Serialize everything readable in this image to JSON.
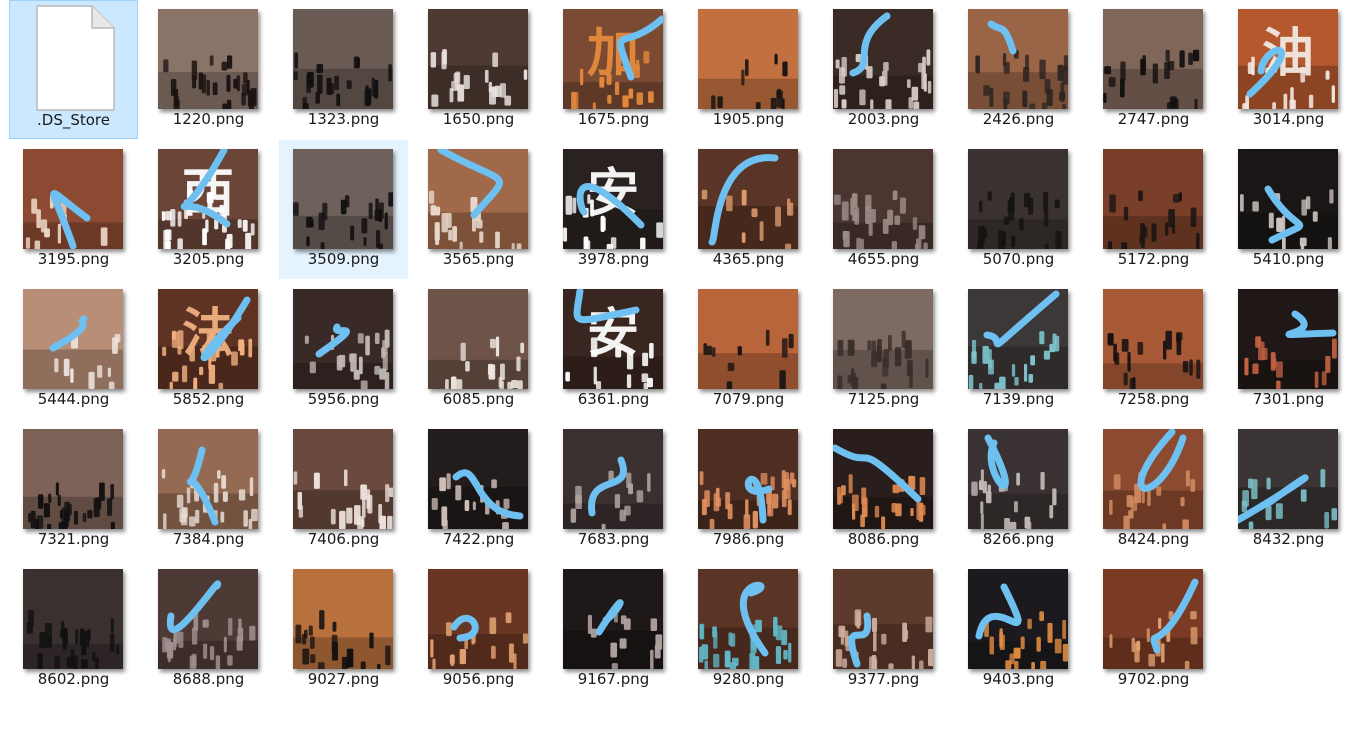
{
  "files": [
    {
      "name": ".DS_Store",
      "type": "file",
      "selected": true
    },
    {
      "name": "1220.png",
      "type": "image",
      "bg": "#8a7468",
      "fg": "#1a1312",
      "ink": false,
      "glyph": ""
    },
    {
      "name": "1323.png",
      "type": "image",
      "bg": "#6b5b55",
      "fg": "#121010",
      "ink": false,
      "glyph": ""
    },
    {
      "name": "1650.png",
      "type": "image",
      "bg": "#4e3a33",
      "fg": "#e9e2de",
      "ink": false,
      "glyph": ""
    },
    {
      "name": "1675.png",
      "type": "image",
      "bg": "#7a4a32",
      "fg": "#e58a3c",
      "ink": true,
      "glyph": "加"
    },
    {
      "name": "1905.png",
      "type": "image",
      "bg": "#c2703f",
      "fg": "#161212",
      "ink": false,
      "glyph": ""
    },
    {
      "name": "2003.png",
      "type": "image",
      "bg": "#3b2b26",
      "fg": "#d9d0ca",
      "ink": true,
      "glyph": ""
    },
    {
      "name": "2426.png",
      "type": "image",
      "bg": "#9a6547",
      "fg": "#2e2522",
      "ink": true,
      "glyph": ""
    },
    {
      "name": "2747.png",
      "type": "image",
      "bg": "#7f6659",
      "fg": "#121010",
      "ink": false,
      "glyph": ""
    },
    {
      "name": "3014.png",
      "type": "image",
      "bg": "#b5582e",
      "fg": "#f3e8e2",
      "ink": true,
      "glyph": "油"
    },
    {
      "name": "3195.png",
      "type": "image",
      "bg": "#8c4a32",
      "fg": "#f0d9c9",
      "ink": true,
      "glyph": ""
    },
    {
      "name": "3205.png",
      "type": "image",
      "bg": "#6a4538",
      "fg": "#ffffff",
      "ink": true,
      "glyph": "西"
    },
    {
      "name": "3509.png",
      "type": "image",
      "bg": "#6e605a",
      "fg": "#121010",
      "ink": false,
      "glyph": "",
      "hover": true
    },
    {
      "name": "3565.png",
      "type": "image",
      "bg": "#a06a4a",
      "fg": "#e8d8cc",
      "ink": true,
      "glyph": ""
    },
    {
      "name": "3978.png",
      "type": "image",
      "bg": "#2a2221",
      "fg": "#ffffff",
      "ink": true,
      "glyph": "安"
    },
    {
      "name": "4365.png",
      "type": "image",
      "bg": "#5a3426",
      "fg": "#e0a070",
      "ink": true,
      "glyph": ""
    },
    {
      "name": "4655.png",
      "type": "image",
      "bg": "#4a3530",
      "fg": "#9a8a85",
      "ink": false,
      "glyph": ""
    },
    {
      "name": "5070.png",
      "type": "image",
      "bg": "#3a3231",
      "fg": "#151212",
      "ink": false,
      "glyph": ""
    },
    {
      "name": "5172.png",
      "type": "image",
      "bg": "#7a3f28",
      "fg": "#1a1414",
      "ink": false,
      "glyph": ""
    },
    {
      "name": "5410.png",
      "type": "image",
      "bg": "#1a1616",
      "fg": "#d0c8c5",
      "ink": true,
      "glyph": ""
    },
    {
      "name": "5444.png",
      "type": "image",
      "bg": "#b88e77",
      "fg": "#efe6e0",
      "ink": true,
      "glyph": ""
    },
    {
      "name": "5852.png",
      "type": "image",
      "bg": "#5f3323",
      "fg": "#f0b080",
      "ink": true,
      "glyph": "法"
    },
    {
      "name": "5956.png",
      "type": "image",
      "bg": "#3a2a27",
      "fg": "#c0b8b5",
      "ink": true,
      "glyph": ""
    },
    {
      "name": "6085.png",
      "type": "image",
      "bg": "#6e5348",
      "fg": "#eee6e0",
      "ink": false,
      "glyph": ""
    },
    {
      "name": "6361.png",
      "type": "image",
      "bg": "#3a2621",
      "fg": "#ffffff",
      "ink": true,
      "glyph": "安"
    },
    {
      "name": "7079.png",
      "type": "image",
      "bg": "#b9653b",
      "fg": "#141111",
      "ink": false,
      "glyph": ""
    },
    {
      "name": "7125.png",
      "type": "image",
      "bg": "#7d6a62",
      "fg": "#3a2e2a",
      "ink": false,
      "glyph": ""
    },
    {
      "name": "7139.png",
      "type": "image",
      "bg": "#3d3838",
      "fg": "#7fc6d0",
      "ink": true,
      "glyph": ""
    },
    {
      "name": "7258.png",
      "type": "image",
      "bg": "#a85a36",
      "fg": "#141111",
      "ink": false,
      "glyph": ""
    },
    {
      "name": "7301.png",
      "type": "image",
      "bg": "#1f1817",
      "fg": "#c06040",
      "ink": true,
      "glyph": ""
    },
    {
      "name": "7321.png",
      "type": "image",
      "bg": "#7c6257",
      "fg": "#121010",
      "ink": false,
      "glyph": ""
    },
    {
      "name": "7384.png",
      "type": "image",
      "bg": "#946a52",
      "fg": "#e8dcd4",
      "ink": true,
      "glyph": ""
    },
    {
      "name": "7406.png",
      "type": "image",
      "bg": "#6a4a3e",
      "fg": "#efe4de",
      "ink": false,
      "glyph": ""
    },
    {
      "name": "7422.png",
      "type": "image",
      "bg": "#221c1c",
      "fg": "#d0c0b8",
      "ink": true,
      "glyph": ""
    },
    {
      "name": "7683.png",
      "type": "image",
      "bg": "#3a3030",
      "fg": "#b0a6a2",
      "ink": true,
      "glyph": ""
    },
    {
      "name": "7986.png",
      "type": "image",
      "bg": "#4e2e22",
      "fg": "#e09060",
      "ink": true,
      "glyph": ""
    },
    {
      "name": "8086.png",
      "type": "image",
      "bg": "#2a1e1c",
      "fg": "#e08a50",
      "ink": true,
      "glyph": ""
    },
    {
      "name": "8266.png",
      "type": "image",
      "bg": "#3a3232",
      "fg": "#c0b8b5",
      "ink": true,
      "glyph": ""
    },
    {
      "name": "8424.png",
      "type": "image",
      "bg": "#8c4a30",
      "fg": "#d08a60",
      "ink": true,
      "glyph": ""
    },
    {
      "name": "8432.png",
      "type": "image",
      "bg": "#3a3434",
      "fg": "#7fc6d0",
      "ink": true,
      "glyph": ""
    },
    {
      "name": "8602.png",
      "type": "image",
      "bg": "#3a3030",
      "fg": "#111010",
      "ink": false,
      "glyph": ""
    },
    {
      "name": "8688.png",
      "type": "image",
      "bg": "#4e3a34",
      "fg": "#a09090",
      "ink": true,
      "glyph": ""
    },
    {
      "name": "9027.png",
      "type": "image",
      "bg": "#b8703d",
      "fg": "#141111",
      "ink": false,
      "glyph": ""
    },
    {
      "name": "9056.png",
      "type": "image",
      "bg": "#6a3624",
      "fg": "#e0a070",
      "ink": true,
      "glyph": ""
    },
    {
      "name": "9167.png",
      "type": "image",
      "bg": "#1e1818",
      "fg": "#b0a0a0",
      "ink": true,
      "glyph": ""
    },
    {
      "name": "9280.png",
      "type": "image",
      "bg": "#5a3424",
      "fg": "#60b8c8",
      "ink": true,
      "glyph": ""
    },
    {
      "name": "9377.png",
      "type": "image",
      "bg": "#5e3a2c",
      "fg": "#d0b0a0",
      "ink": true,
      "glyph": ""
    },
    {
      "name": "9403.png",
      "type": "image",
      "bg": "#1c1a1e",
      "fg": "#e08a40",
      "ink": true,
      "glyph": ""
    },
    {
      "name": "9702.png",
      "type": "image",
      "bg": "#7a3a24",
      "fg": "#e0a070",
      "ink": true,
      "glyph": ""
    }
  ],
  "colors": {
    "ink": "#6ec0f0",
    "selected_bg": "#cce8ff",
    "hover_bg": "#e5f3ff"
  }
}
